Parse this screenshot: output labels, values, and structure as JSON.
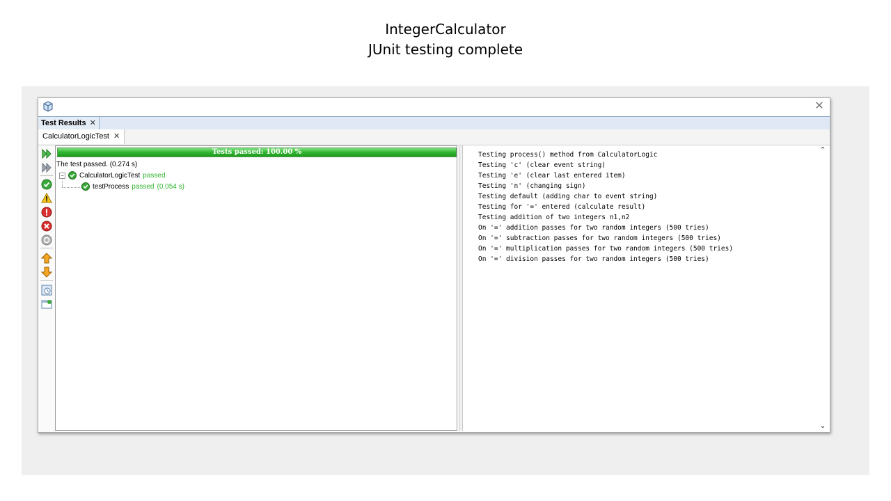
{
  "slide": {
    "title_line1": "IntegerCalculator",
    "title_line2": "JUnit testing complete"
  },
  "window": {
    "close_glyph": "✕",
    "tab_label": "Test Results",
    "subtab_label": "CalculatorLogicTest"
  },
  "results": {
    "progress_label": "Tests passed: 100.00 %",
    "progress_fraction": 1.0,
    "summary": "The test passed. (0.274 s)",
    "suite": {
      "name": "CalculatorLogicTest",
      "status": "passed"
    },
    "test": {
      "name": "testProcess",
      "status": "passed",
      "time": "(0.054 s)"
    }
  },
  "toolbar_icons": [
    "rerun-icon",
    "rerun-failed-icon",
    "show-passed-icon",
    "show-warnings-icon",
    "show-failures-icon",
    "show-errors-icon",
    "show-aborted-icon",
    "previous-failure-icon",
    "next-failure-icon",
    "history-icon",
    "export-icon"
  ],
  "output_lines": [
    "Testing process() method from CalculatorLogic",
    "Testing 'c' (clear event string)",
    "Testing 'e' (clear last entered item)",
    "Testing 'n' (changing sign)",
    "Testing default (adding char to event string)",
    "Testing for '=' entered (calculate result)",
    "Testing addition of two integers n1,n2",
    "On '=' addition passes for two random integers (500 tries)",
    "On '=' subtraction passes for two random integers (500 tries)",
    "On '=' multiplication passes for two random integers (500 tries)",
    "On '=' division passes for two random integers (500 tries)"
  ],
  "colors": {
    "pass_green": "#2fb52f",
    "tab_blue": "#dfe8f4"
  }
}
